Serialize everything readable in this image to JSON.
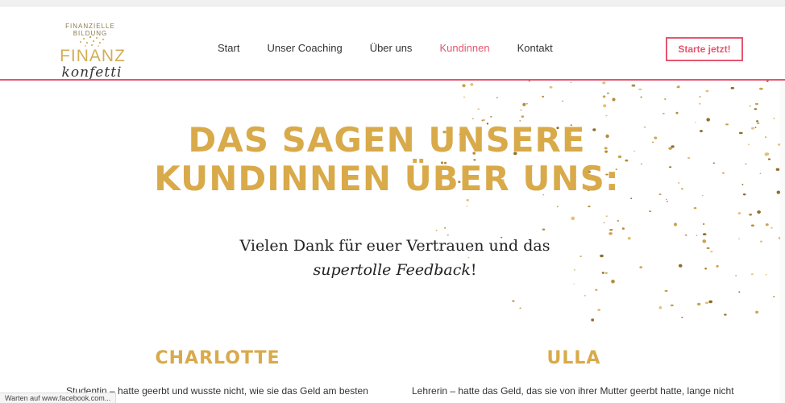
{
  "logo": {
    "arc_text": "FINANZIELLE BILDUNG",
    "main": "FINANZ",
    "script": "konfetti"
  },
  "nav": [
    "Start",
    "Unser Coaching",
    "Über uns",
    "Kundinnen",
    "Kontakt"
  ],
  "active_nav": "Kundinnen",
  "cta_label": "Starte jetzt!",
  "hero": {
    "title_line1": "DAS SAGEN UNSERE",
    "title_line2": "KUNDINNEN ÜBER UNS:",
    "subtitle_line1": "Vielen Dank für euer Vertrauen und das",
    "subtitle_em": "supertolle Feedback",
    "subtitle_end": "!"
  },
  "testimonials": [
    {
      "name": "CHARLOTTE",
      "text": "Studentin – hatte geerbt und wusste nicht, wie sie das Geld am besten"
    },
    {
      "name": "ULLA",
      "text": "Lehrerin – hatte das Geld, das sie von ihrer Mutter geerbt hatte, lange nicht"
    }
  ],
  "status_text": "Warten auf www.facebook.com...",
  "colors": {
    "accent": "#e5556f",
    "gold": "#d9aa4a"
  }
}
